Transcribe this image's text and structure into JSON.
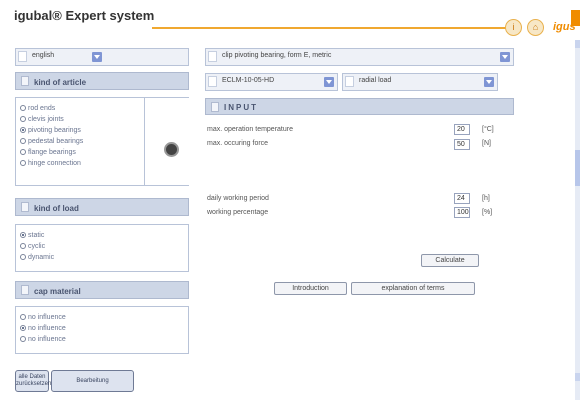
{
  "header": {
    "title": "igubal® Expert system",
    "logo": "igus"
  },
  "language": {
    "selected": "english"
  },
  "article_section": {
    "title": "kind of article"
  },
  "article_options": [
    {
      "label": "rod ends",
      "checked": false
    },
    {
      "label": "clevis joints",
      "checked": false
    },
    {
      "label": "pivoting bearings",
      "checked": true
    },
    {
      "label": "pedestal bearings",
      "checked": false
    },
    {
      "label": "flange bearings",
      "checked": false
    },
    {
      "label": "hinge connection",
      "checked": false
    }
  ],
  "load_section": {
    "title": "kind of load"
  },
  "load_options": [
    {
      "label": "static",
      "checked": true
    },
    {
      "label": "cyclic",
      "checked": false
    },
    {
      "label": "dynamic",
      "checked": false
    }
  ],
  "cap_section": {
    "title": "cap material"
  },
  "cap_options": [
    {
      "label": "no influence",
      "checked": false
    },
    {
      "label": "no influence",
      "checked": true
    },
    {
      "label": "no influence",
      "checked": false
    }
  ],
  "product_select": {
    "selected": "clip pivoting bearing, form E, metric"
  },
  "model_select": {
    "selected": "ECLM-10-05-HD"
  },
  "load_type_select": {
    "selected": "radial load"
  },
  "input_section": {
    "title": "INPUT"
  },
  "fields": {
    "max_temp": {
      "label": "max. operation temperature",
      "value": "20",
      "unit": "[°C]"
    },
    "max_force": {
      "label": "max. occuring force",
      "value": "50",
      "unit": "[N]"
    },
    "daily_period": {
      "label": "daily working period",
      "value": "24",
      "unit": "[h]"
    },
    "percentage": {
      "label": "working percentage",
      "value": "100",
      "unit": "[%]"
    }
  },
  "buttons": {
    "calculate": "Calculate",
    "introduction": "Introduction",
    "explanation": "explanation of terms",
    "bottom_left": "alle Daten zurücksetzen",
    "bottom_right": "Bearbeitung"
  }
}
